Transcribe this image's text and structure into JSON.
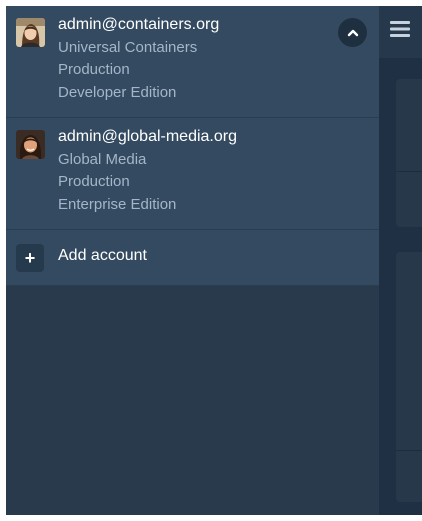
{
  "accounts": [
    {
      "username": "admin@containers.org",
      "org_name": "Universal Containers",
      "environment": "Production",
      "edition": "Developer Edition"
    },
    {
      "username": "admin@global-media.org",
      "org_name": "Global Media",
      "environment": "Production",
      "edition": "Enterprise Edition"
    }
  ],
  "add_account": {
    "label": "Add account",
    "icon": "plus-icon"
  },
  "collapse_icon": "chevron-up-icon",
  "menu_icon": "hamburger-menu-icon",
  "colors": {
    "drawer_background": "#283a4c",
    "account_list_background": "#344a60",
    "primary_text": "#ffffff",
    "secondary_text": "#a4b6c8"
  }
}
